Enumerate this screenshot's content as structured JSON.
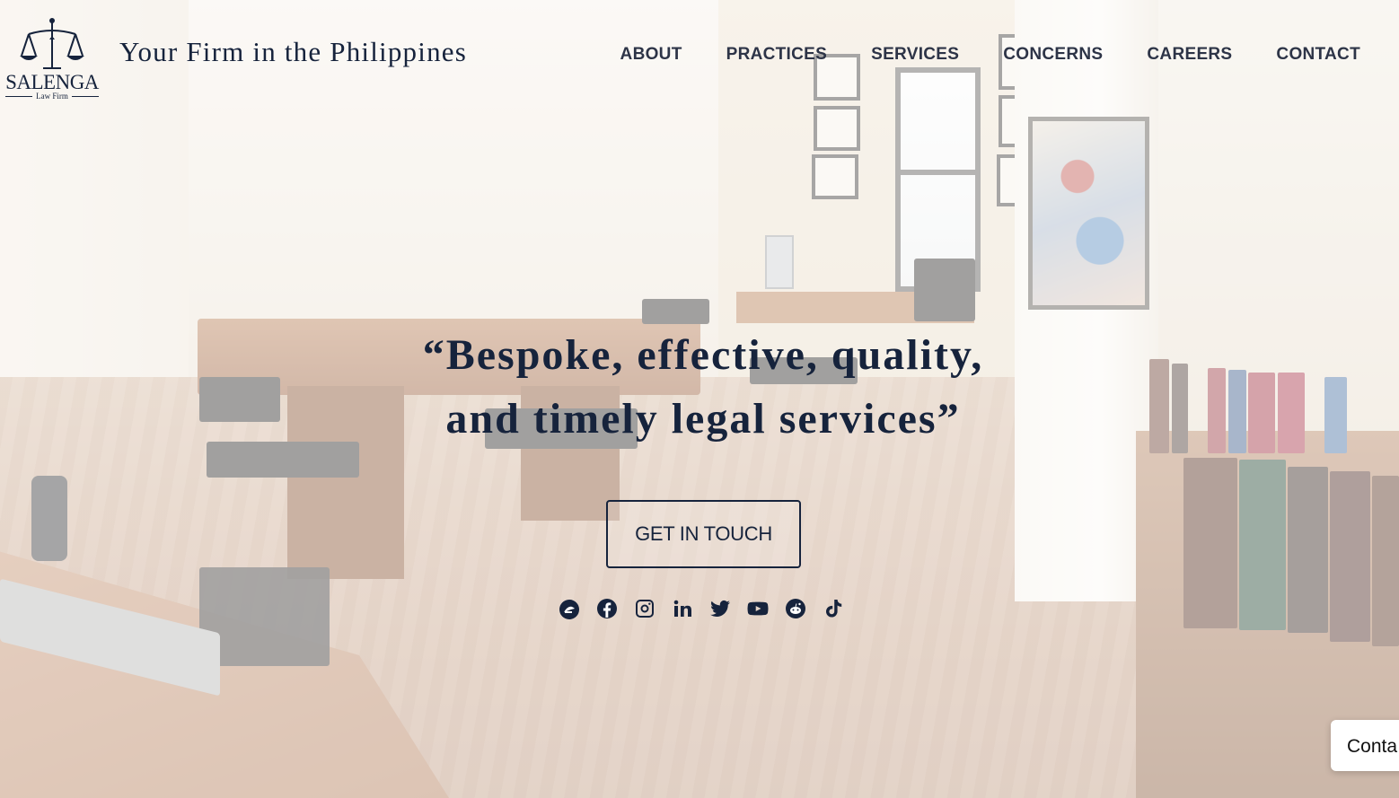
{
  "brand": {
    "logo_wordmark": "SALENGA",
    "logo_subtitle": "Law Firm",
    "logo_icon": "scales-of-justice-icon",
    "tagline": "Your Firm in the Philippines",
    "color_navy": "#16233c"
  },
  "nav": {
    "items": [
      {
        "label": "ABOUT"
      },
      {
        "label": "PRACTICES"
      },
      {
        "label": "SERVICES"
      },
      {
        "label": "CONCERNS"
      },
      {
        "label": "CAREERS"
      },
      {
        "label": "CONTACT"
      }
    ]
  },
  "hero": {
    "quote_line1": "“Bespoke, effective, quality,",
    "quote_line2": "and timely legal services”",
    "cta_label": "GET IN TOUCH"
  },
  "social": {
    "icons": [
      "blog-icon",
      "facebook-icon",
      "instagram-icon",
      "linkedin-icon",
      "twitter-icon",
      "youtube-icon",
      "reddit-icon",
      "tiktok-icon"
    ]
  },
  "widget": {
    "contact_tab_label": "Conta"
  }
}
